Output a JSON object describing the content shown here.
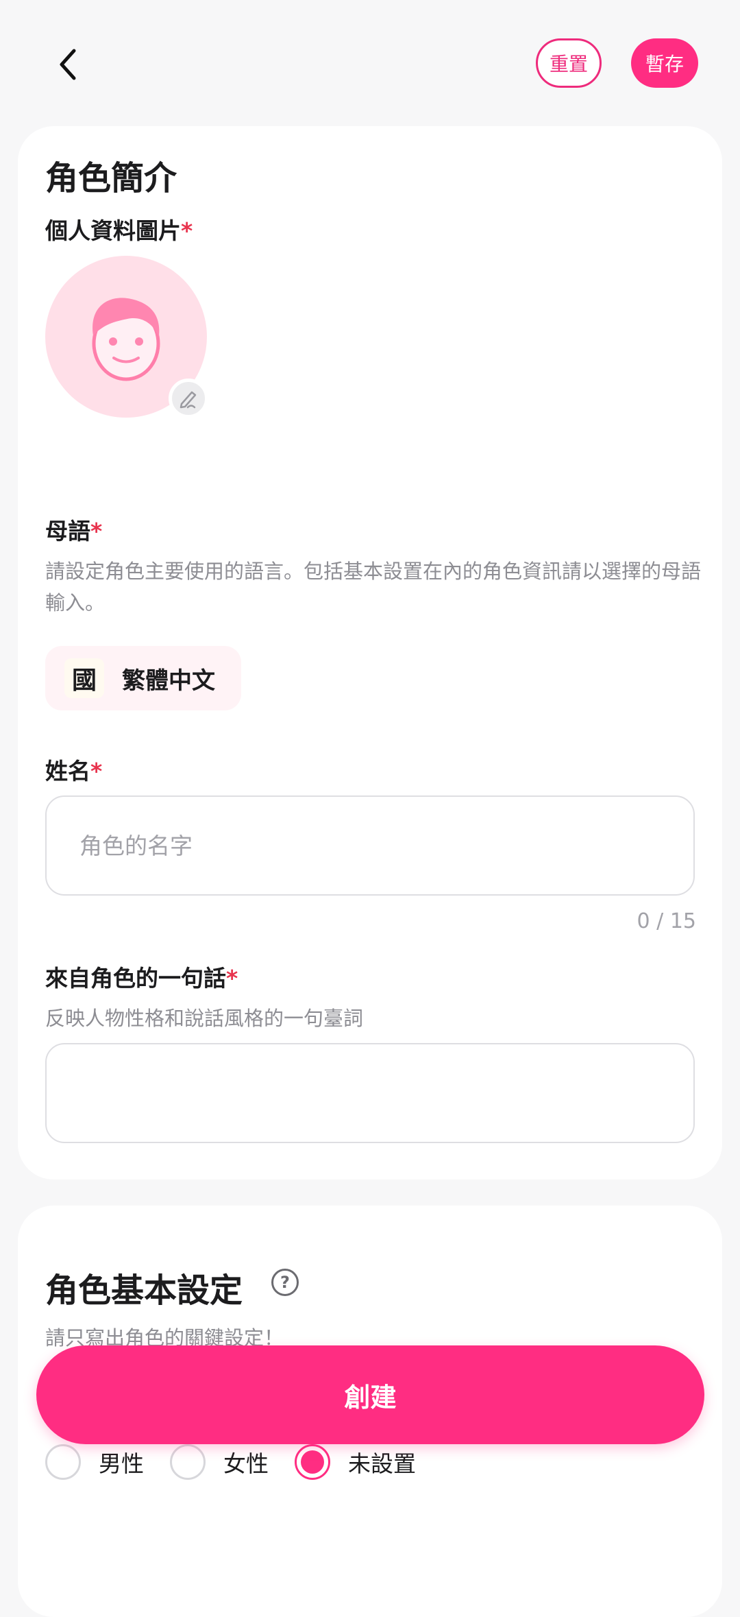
{
  "header": {
    "reset_label": "重置",
    "save_label": "暫存"
  },
  "profile": {
    "section_title": "角色簡介",
    "avatar_label": "個人資料圖片",
    "required_mark": "*"
  },
  "language": {
    "label": "母語",
    "hint": "請設定角色主要使用的語言。包括基本設置在內的角色資訊請以選擇的母語輸入。",
    "flag_glyph": "國",
    "selected": "繁體中文"
  },
  "name": {
    "label": "姓名",
    "placeholder": "角色的名字",
    "value": "",
    "counter": "0 / 15"
  },
  "quote": {
    "label": "來自角色的一句話",
    "hint": "反映人物性格和說話風格的一句臺詞",
    "value": ""
  },
  "basic_settings": {
    "title": "角色基本設定",
    "hint": "請只寫出角色的關鍵設定！"
  },
  "create_label": "創建",
  "gender": {
    "options": [
      "男性",
      "女性",
      "未設置"
    ],
    "selected_index": 2
  },
  "colors": {
    "accent": "#ff2d82",
    "required": "#e8344e",
    "avatar_bg": "#ffdfe8"
  }
}
